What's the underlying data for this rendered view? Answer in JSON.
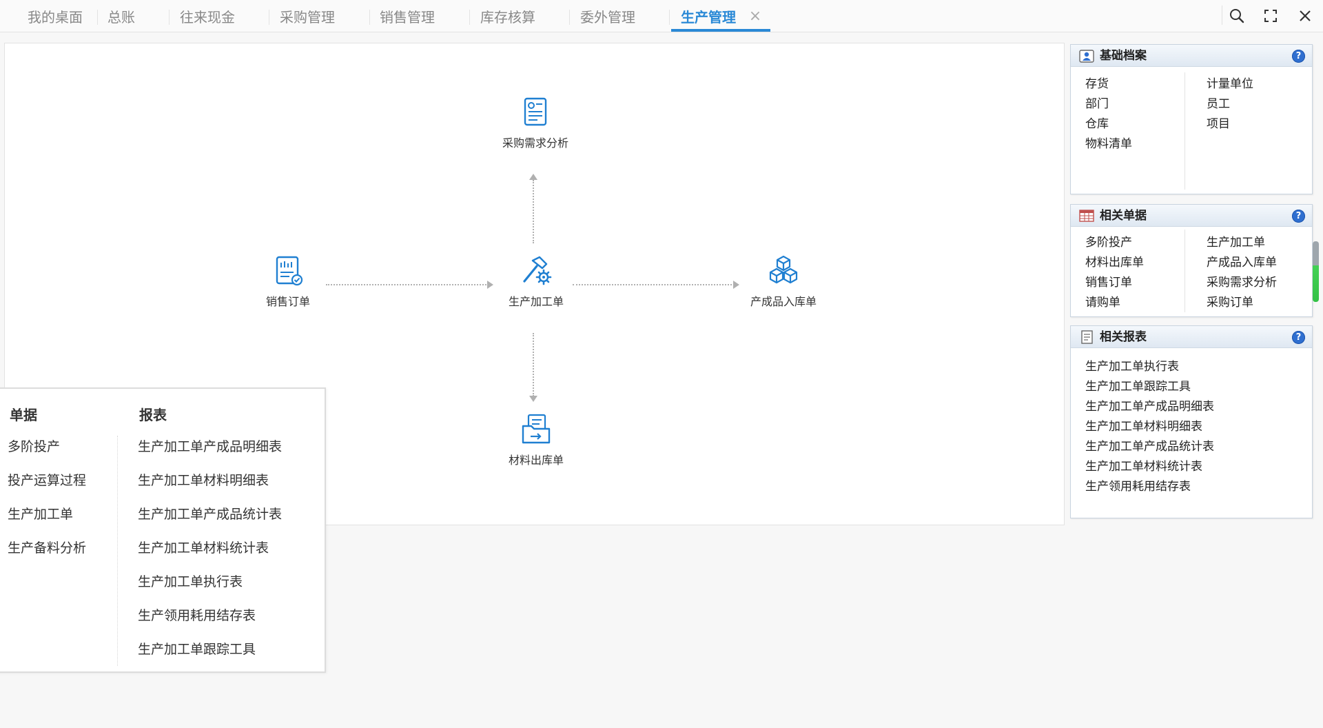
{
  "tabs": [
    {
      "label": "我的桌面"
    },
    {
      "label": "总账"
    },
    {
      "label": "往来现金"
    },
    {
      "label": "采购管理"
    },
    {
      "label": "销售管理"
    },
    {
      "label": "库存核算"
    },
    {
      "label": "委外管理"
    },
    {
      "label": "生产管理"
    }
  ],
  "active_tab": "生产管理",
  "tab_close": "×",
  "flow": {
    "purchase_demand": "采购需求分析",
    "sales_order": "销售订单",
    "production_order": "生产加工单",
    "finished_goods_in": "产成品入库单",
    "material_out": "材料出库单"
  },
  "popup": {
    "documents_title": "单据",
    "reports_title": "报表",
    "documents": [
      "多阶投产",
      "投产运算过程",
      "生产加工单",
      "生产备料分析"
    ],
    "reports": [
      "生产加工单产成品明细表",
      "生产加工单材料明细表",
      "生产加工单产成品统计表",
      "生产加工单材料统计表",
      "生产加工单执行表",
      "生产领用耗用结存表",
      "生产加工单跟踪工具"
    ]
  },
  "panels": {
    "basic": {
      "title": "基础档案",
      "left": [
        "存货",
        "部门",
        "仓库",
        "物料清单"
      ],
      "right": [
        "计量单位",
        "员工",
        "项目"
      ]
    },
    "docs": {
      "title": "相关单据",
      "left": [
        "多阶投产",
        "材料出库单",
        "销售订单",
        "请购单"
      ],
      "right": [
        "生产加工单",
        "产成品入库单",
        "采购需求分析",
        "采购订单"
      ]
    },
    "reports": {
      "title": "相关报表",
      "items": [
        "生产加工单执行表",
        "生产加工单跟踪工具",
        "生产加工单产成品明细表",
        "生产加工单材料明细表",
        "生产加工单产成品统计表",
        "生产加工单材料统计表",
        "生产领用耗用结存表"
      ]
    }
  },
  "help_label": "?",
  "colors": {
    "accent": "#2a89d6",
    "icon_blue": "#1f7fd1",
    "help_blue": "#2f6fd0"
  },
  "icons": [
    "search-icon",
    "maximize-icon",
    "close-icon",
    "document-icon",
    "hammer-gear-icon",
    "cubes-icon",
    "folder-arrow-icon",
    "user-card-icon",
    "table-grid-icon",
    "report-icon",
    "help-icon"
  ]
}
